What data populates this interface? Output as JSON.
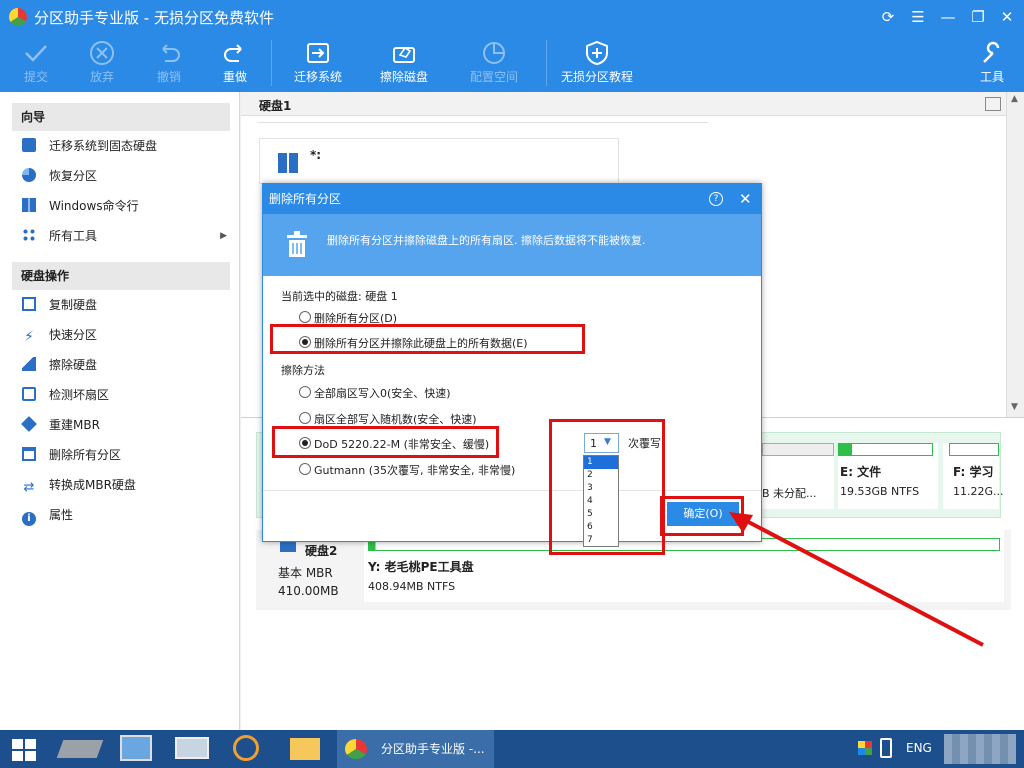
{
  "window": {
    "title": "分区助手专业版 - 无损分区免费软件"
  },
  "toolbar": {
    "commit": "提交",
    "discard": "放弃",
    "undo": "撤销",
    "redo": "重做",
    "migrate": "迁移系统",
    "wipe": "擦除磁盘",
    "alloc": "配置空间",
    "tutorial": "无损分区教程",
    "tools": "工具"
  },
  "sidebar": {
    "wizard_title": "向导",
    "wizard_items": [
      "迁移系统到固态硬盘",
      "恢复分区",
      "Windows命令行",
      "所有工具"
    ],
    "disk_title": "硬盘操作",
    "disk_items": [
      "复制硬盘",
      "快速分区",
      "擦除硬盘",
      "检测坏扇区",
      "重建MBR",
      "删除所有分区",
      "转换成MBR硬盘",
      "属性"
    ]
  },
  "main": {
    "disk1_label": "硬盘1",
    "sys_drive": "*:",
    "unalloc_text": "B 未分配...",
    "e_name": "E: 文件",
    "e_info": "19.53GB NTFS",
    "f_name": "F: 学习",
    "f_info": "11.22G...",
    "disk2_name": "硬盘2",
    "disk2_type": "基本 MBR",
    "disk2_size": "410.00MB",
    "y_name": "Y: 老毛桃PE工具盘",
    "y_info": "408.94MB NTFS"
  },
  "dialog": {
    "title": "删除所有分区",
    "banner": "删除所有分区并擦除磁盘上的所有扇区. 擦除后数据将不能被恢复.",
    "current_disk": "当前选中的磁盘: 硬盘 1",
    "opt_delete": "删除所有分区(D)",
    "opt_wipe": "删除所有分区并擦除此硬盘上的所有数据(E)",
    "method_label": "擦除方法",
    "m1": "全部扇区写入0(安全、快速)",
    "m2": "扇区全部写入随机数(安全、快速)",
    "m3": "DoD 5220.22-M (非常安全、缓慢)",
    "m4": "Gutmann (35次覆写, 非常安全, 非常慢)",
    "passes_value": "1",
    "passes_options": [
      "1",
      "2",
      "3",
      "4",
      "5",
      "6",
      "7"
    ],
    "passes_suffix": "次覆写",
    "ok": "确定(O)"
  },
  "taskbar": {
    "app_label": "分区助手专业版 -...",
    "lang": "ENG"
  },
  "colors": {
    "accent": "#2b8ae6",
    "highlight": "#e01010",
    "bar_green": "#2dbf4a"
  }
}
